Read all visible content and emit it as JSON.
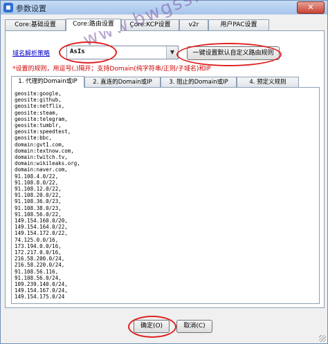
{
  "window": {
    "title": "参数设置",
    "close_glyph": "✕"
  },
  "top_tabs": [
    {
      "label": "Core:基础设置"
    },
    {
      "label": "Core:路由设置"
    },
    {
      "label": "Core:KCP设置"
    },
    {
      "label": "v2r"
    },
    {
      "label": "用户PAC设置"
    }
  ],
  "routing": {
    "strategy_link": "域名解析策略",
    "strategy_value": "AsIs",
    "restore_button": "一键设置默认自定义路由规则",
    "hint": "*设置的规则，用逗号(,)隔开；支持Domain(纯字符串/正则/子域名)和IP"
  },
  "sub_tabs": [
    {
      "label": "1. 代理的Domain或IP"
    },
    {
      "label": "2. 直连的Domain或IP"
    },
    {
      "label": "3. 阻止的Domain或IP"
    },
    {
      "label": "4. 预定义规则"
    }
  ],
  "rules": [
    "geosite:google,",
    "geosite:github,",
    "geosite:netflix,",
    "geosite:steam,",
    "geosite:telegram,",
    "geosite:tumblr,",
    "geosite:speedtest,",
    "geosite:bbc,",
    "domain:gvt1.com,",
    "domain:textnow.com,",
    "domain:twitch.tv,",
    "domain:wikileaks.org,",
    "domain:naver.com,",
    "91.108.4.0/22,",
    "91.108.8.0/22,",
    "91.108.12.0/22,",
    "91.108.20.0/22,",
    "91.108.36.0/23,",
    "91.108.38.0/23,",
    "91.108.56.0/22,",
    "149.154.160.0/20,",
    "149.154.164.0/22,",
    "149.154.172.0/22,",
    "74.125.0.0/16,",
    "173.194.0.0/16,",
    "172.217.0.0/16,",
    "216.58.200.0/24,",
    "216.58.220.0/24,",
    "91.108.56.116,",
    "91.108.56.0/24,",
    "109.239.140.0/24,",
    "149.154.167.0/24,",
    "149.154.175.0/24"
  ],
  "footer": {
    "ok": "确定(O)",
    "cancel": "取消(C)"
  },
  "watermark": "www.bwgss.org",
  "colors": {
    "hint": "#cc0000",
    "link": "#0000cc",
    "annotation_ring": "#e02020",
    "watermark": "#7b5ba8"
  }
}
